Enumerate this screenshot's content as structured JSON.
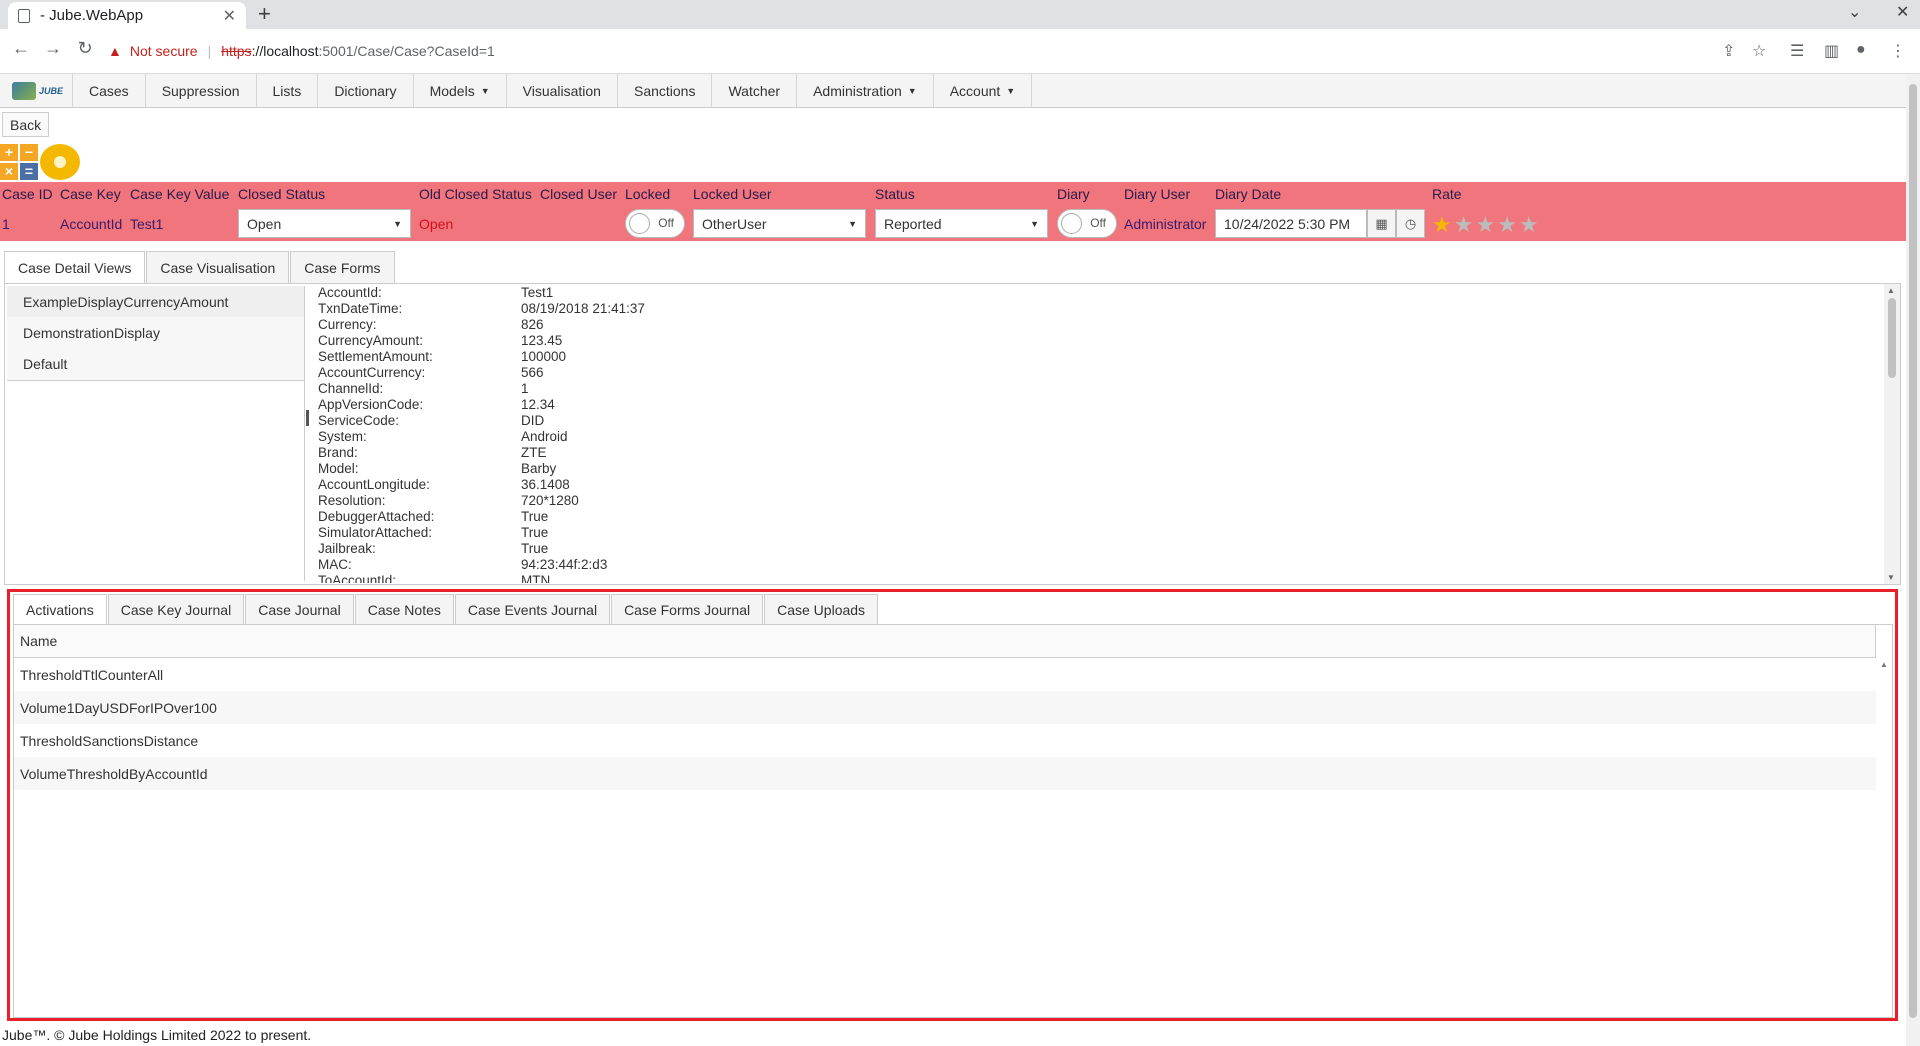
{
  "browser": {
    "tab_title": "- Jube.WebApp",
    "not_secure": "Not secure",
    "url_scheme": "https",
    "url_host": "://localhost",
    "url_rest": ":5001/Case/Case?CaseId=1"
  },
  "nav": {
    "logo_text": "JUBE",
    "items": [
      "Cases",
      "Suppression",
      "Lists",
      "Dictionary",
      "Models",
      "Visualisation",
      "Sanctions",
      "Watcher",
      "Administration",
      "Account"
    ]
  },
  "back_label": "Back",
  "case_header": {
    "labels": {
      "case_id": "Case ID",
      "case_key": "Case Key",
      "case_key_value": "Case Key Value",
      "closed_status": "Closed Status",
      "old_closed_status": "Old Closed Status",
      "closed_user": "Closed User",
      "locked": "Locked",
      "locked_user": "Locked User",
      "status": "Status",
      "diary": "Diary",
      "diary_user": "Diary User",
      "diary_date": "Diary Date",
      "rate": "Rate"
    },
    "values": {
      "case_id": "1",
      "case_key": "AccountId",
      "case_key_value": "Test1",
      "closed_status": "Open",
      "old_closed_status": "Open",
      "locked": "Off",
      "locked_user": "OtherUser",
      "status": "Reported",
      "diary": "Off",
      "diary_user": "Administrator",
      "diary_date": "10/24/2022 5:30 PM",
      "rating": 1,
      "rating_max": 5
    },
    "band_color": "#f0757d"
  },
  "top_tabs": [
    "Case Detail Views",
    "Case Visualisation",
    "Case Forms"
  ],
  "views": [
    "ExampleDisplayCurrencyAmount",
    "DemonstrationDisplay",
    "Default"
  ],
  "fields": [
    {
      "k": "AccountId:",
      "v": "Test1"
    },
    {
      "k": "TxnDateTime:",
      "v": "08/19/2018 21:41:37"
    },
    {
      "k": "Currency:",
      "v": "826"
    },
    {
      "k": "CurrencyAmount:",
      "v": "123.45"
    },
    {
      "k": "SettlementAmount:",
      "v": "100000"
    },
    {
      "k": "AccountCurrency:",
      "v": "566"
    },
    {
      "k": "ChannelId:",
      "v": "1"
    },
    {
      "k": "AppVersionCode:",
      "v": "12.34"
    },
    {
      "k": "ServiceCode:",
      "v": "DID"
    },
    {
      "k": "System:",
      "v": "Android"
    },
    {
      "k": "Brand:",
      "v": "ZTE"
    },
    {
      "k": "Model:",
      "v": "Barby"
    },
    {
      "k": "AccountLongitude:",
      "v": "36.1408"
    },
    {
      "k": "Resolution:",
      "v": "720*1280"
    },
    {
      "k": "DebuggerAttached:",
      "v": "True"
    },
    {
      "k": "SimulatorAttached:",
      "v": "True"
    },
    {
      "k": "Jailbreak:",
      "v": "True"
    },
    {
      "k": "MAC:",
      "v": "94:23:44f:2:d3"
    },
    {
      "k": "ToAccountId:",
      "v": "MTN"
    }
  ],
  "bottom_tabs": [
    "Activations",
    "Case Key Journal",
    "Case Journal",
    "Case Notes",
    "Case Events Journal",
    "Case Forms Journal",
    "Case Uploads"
  ],
  "activations": {
    "column": "Name",
    "rows": [
      "ThresholdTtlCounterAll",
      "Volume1DayUSDForIPOver100",
      "ThresholdSanctionsDistance",
      "VolumeThresholdByAccountId"
    ]
  },
  "footer": "Jube™. © Jube Holdings Limited 2022 to present."
}
